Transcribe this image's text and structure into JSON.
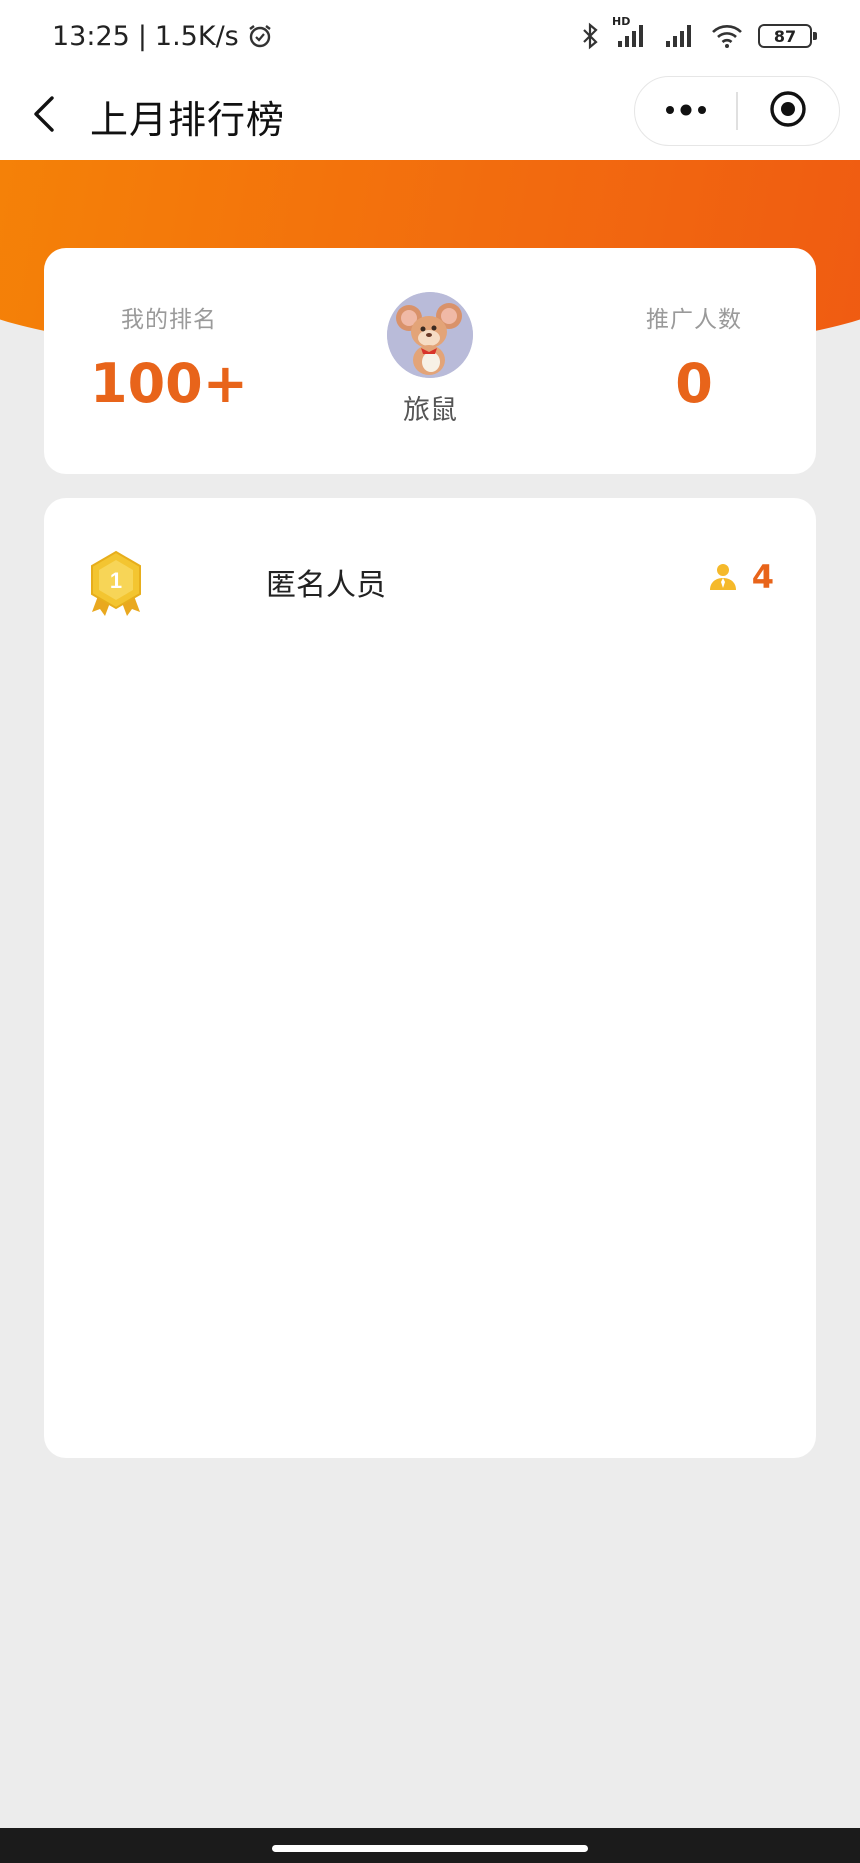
{
  "status_bar": {
    "time": "13:25",
    "separator": "|",
    "net_speed": "1.5K/s",
    "hd_label": "HD",
    "battery": "87",
    "icons": [
      "alarm-icon",
      "bluetooth-icon",
      "signal-icon",
      "wifi-icon",
      "battery-icon"
    ]
  },
  "nav": {
    "title": "上月排行榜",
    "icons": [
      "back-arrow-icon",
      "more-dots-icon",
      "target-icon"
    ]
  },
  "stats": {
    "rank_label": "我的排名",
    "rank_value": "100+",
    "user_name": "旅鼠",
    "count_label": "推广人数",
    "count_value": "0"
  },
  "leaderboard": [
    {
      "rank": "1",
      "name": "匿名人员",
      "count": "4",
      "icon": "person-icon"
    }
  ],
  "colors": {
    "accent": "#e8641a",
    "header_gradient_start": "#f58307",
    "header_gradient_end": "#ef5a12",
    "background": "#ececec",
    "medal_gold": "#f2c12e"
  }
}
